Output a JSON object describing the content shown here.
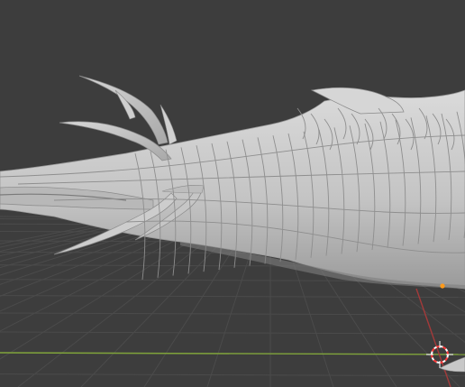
{
  "viewport": {
    "background": "#3d3d3d",
    "grid_color": "#4a4a4a",
    "x_axis_color": "#7fa33a",
    "y_axis_color": "#a33a3a",
    "origin_dot_color": "#ff9a1a",
    "mesh_color": "#c9c9c9",
    "mesh_shadow": "#8c8c8c",
    "mesh_highlight": "#e4e4e4",
    "cursor_colors": [
      "#ff3a3a",
      "#ffffff"
    ]
  },
  "icons": {
    "origin": "origin-dot-icon",
    "cursor": "3d-cursor-icon"
  }
}
